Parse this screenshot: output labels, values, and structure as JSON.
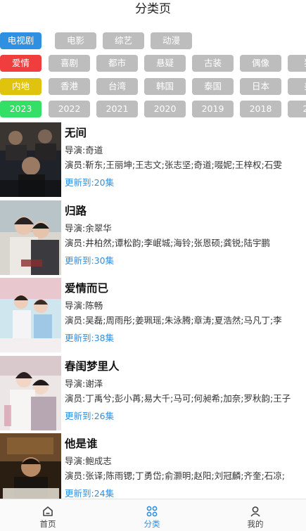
{
  "header": {
    "title": "分类页"
  },
  "filters": {
    "type": {
      "selected_color": "#2f8fe0",
      "options": [
        "电视剧",
        "电影",
        "综艺",
        "动漫"
      ]
    },
    "genre": {
      "selected_color": "#f03e3e",
      "options": [
        "爱情",
        "喜剧",
        "都市",
        "悬疑",
        "古装",
        "偶像",
        "犯"
      ]
    },
    "region": {
      "selected_color": "#e0c30c",
      "options": [
        "内地",
        "香港",
        "台湾",
        "韩国",
        "泰国",
        "日本",
        "美"
      ]
    },
    "year": {
      "selected_color": "#33e065",
      "options": [
        "2023",
        "2022",
        "2021",
        "2020",
        "2019",
        "2018",
        "20"
      ]
    },
    "unselected_color": "#bdbdbd"
  },
  "dramas": [
    {
      "title": "无间",
      "director": "导演:奇道",
      "actors": "演员:靳东;王丽坤;王志文;张志坚;奇道;啜妮;王梓权;石雯",
      "update": "更新到:20集"
    },
    {
      "title": "归路",
      "director": "导演:余翠华",
      "actors": "演员:井柏然;谭松韵;李岷城;海铃;张恩硕;龚锐;陆宇鹏",
      "update": "更新到:30集"
    },
    {
      "title": "爱情而已",
      "director": "导演:陈畅",
      "actors": "演员:吴磊;周雨彤;姜珮瑶;朱泳腾;章涛;夏浩然;马凡丁;李",
      "update": "更新到:38集"
    },
    {
      "title": "春闺梦里人",
      "director": "导演:谢泽",
      "actors": "演员:丁禹兮;彭小苒;易大千;马可;何昶希;加奈;罗秋韵;王子",
      "update": "更新到:26集"
    },
    {
      "title": "他是谁",
      "director": "导演:鲍成志",
      "actors": "演员:张译;陈雨锶;丁勇岱;俞灏明;赵阳;刘冠麟;齐奎;石凉;",
      "update": "更新到:24集"
    }
  ],
  "tabbar": {
    "accent": "#2f8fe0",
    "items": [
      {
        "label": "首页",
        "icon": "home-icon"
      },
      {
        "label": "分类",
        "icon": "category-grid-icon"
      },
      {
        "label": "我的",
        "icon": "user-icon"
      }
    ]
  }
}
